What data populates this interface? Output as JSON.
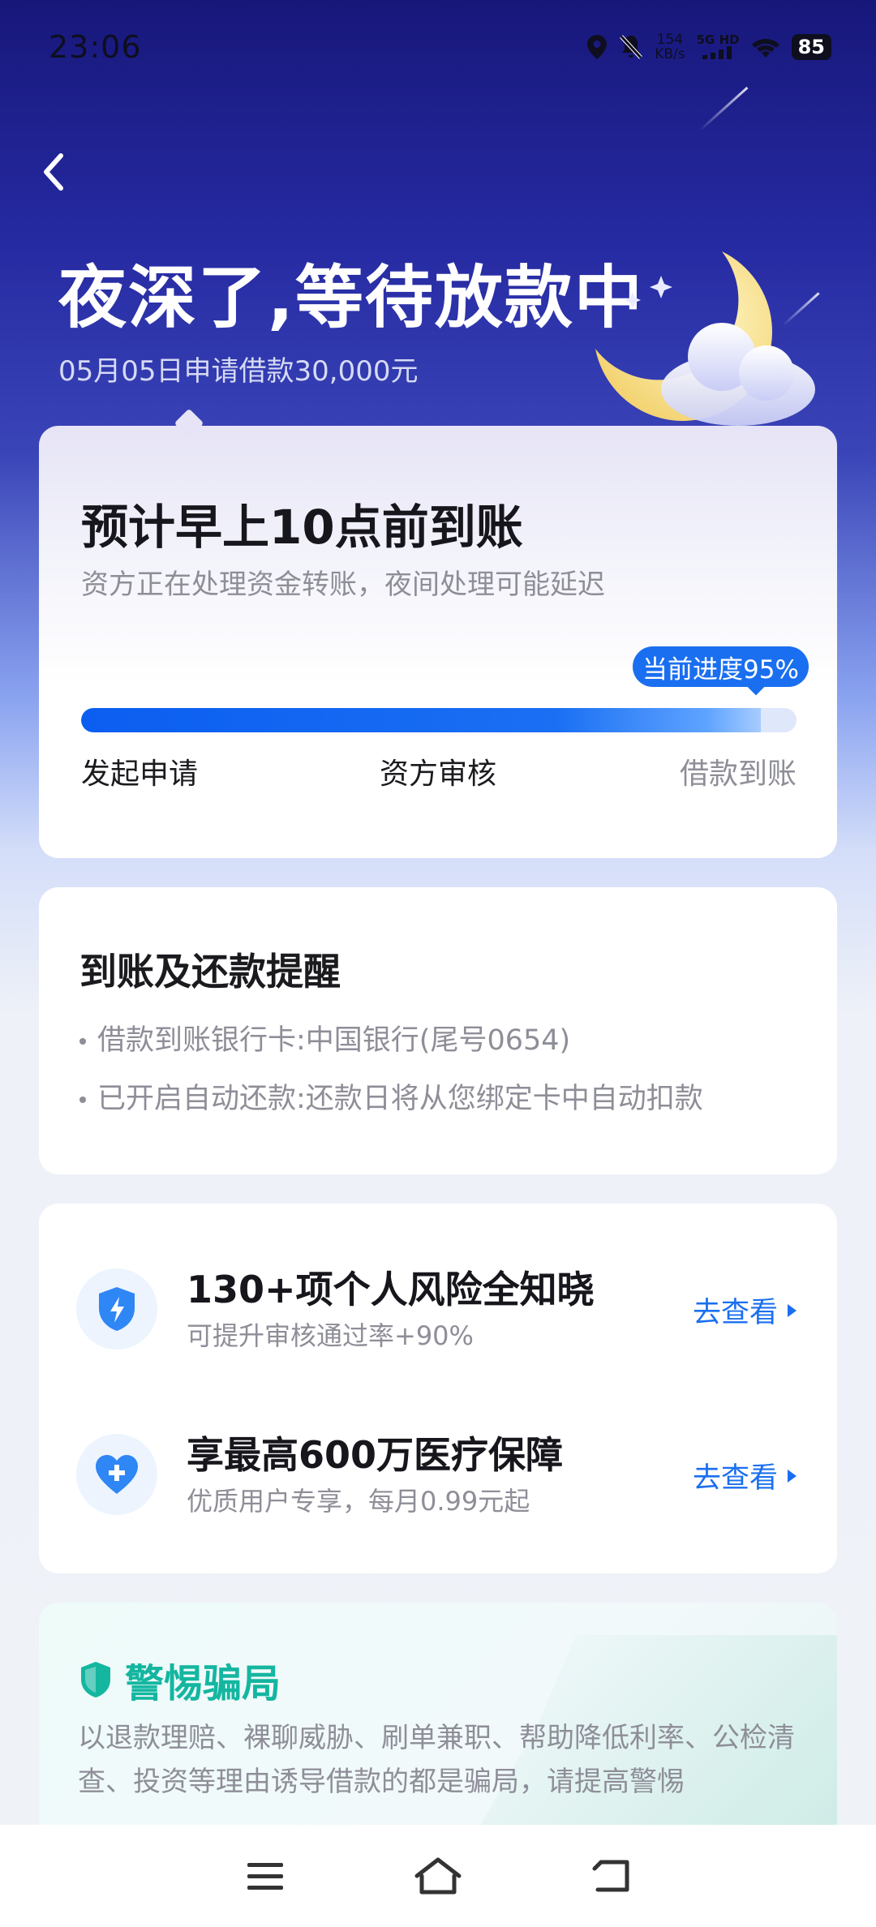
{
  "status_bar": {
    "time": "23:06",
    "speed_value": "154",
    "speed_unit": "KB/s",
    "network": "5G HD",
    "battery": "85",
    "icons": [
      "location-icon",
      "mute-icon",
      "signal-icon",
      "wifi-icon",
      "battery-icon"
    ]
  },
  "hero": {
    "title": "夜深了,等待放款中",
    "subtitle": "05月05日申请借款30,000元"
  },
  "progress_card": {
    "eta": "预计早上10点前到账",
    "description": "资方正在处理资金转账，夜间处理可能延迟",
    "badge": "当前进度95%",
    "progress_percent": 95,
    "steps": [
      "发起申请",
      "资方审核",
      "借款到账"
    ]
  },
  "reminder_card": {
    "title": "到账及还款提醒",
    "lines": [
      "借款到账银行卡:中国银行(尾号0654)",
      "已开启自动还款:还款日将从您绑定卡中自动扣款"
    ]
  },
  "services_card": {
    "items": [
      {
        "title": "130+项个人风险全知晓",
        "subtitle": "可提升审核通过率+90%",
        "link": "去查看",
        "icon": "shield-lightning-icon"
      },
      {
        "title": "享最高600万医疗保障",
        "subtitle": "优质用户专享，每月0.99元起",
        "link": "去查看",
        "icon": "heart-plus-icon"
      }
    ]
  },
  "fraud_card": {
    "title": "警惕骗局",
    "text": "以退款理赔、裸聊威胁、刷单兼职、帮助降低利率、公检清查、投资等理由诱导借款的都是骗局，请提高警惕"
  },
  "nav_bar": {
    "icons": [
      "menu-icon",
      "home-icon",
      "back-icon"
    ]
  },
  "colors": {
    "accent": "#1a6ff0",
    "warning_teal": "#14b6a0",
    "hero_bg": "#1a1a7e"
  }
}
